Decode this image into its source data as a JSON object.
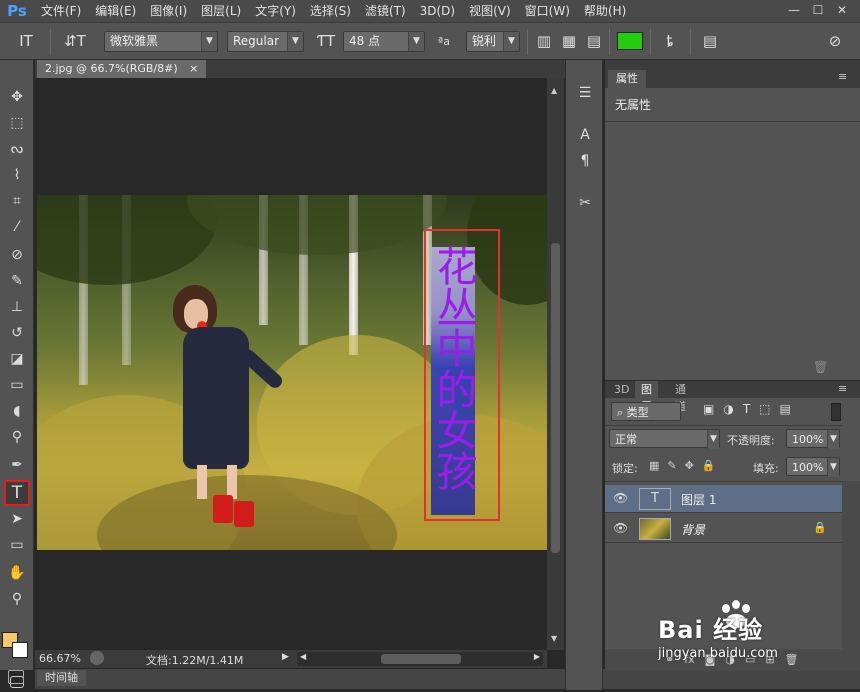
{
  "app": {
    "logo": "Ps"
  },
  "menu": [
    "文件(F)",
    "编辑(E)",
    "图像(I)",
    "图层(L)",
    "文字(Y)",
    "选择(S)",
    "滤镜(T)",
    "3D(D)",
    "视图(V)",
    "窗口(W)",
    "帮助(H)"
  ],
  "window_controls": [
    "—",
    "☐",
    "✕"
  ],
  "options": {
    "font_family": "微软雅黑",
    "font_style": "Regular",
    "font_size": "48 点",
    "aa_label": "ªa",
    "antialias": "锐利",
    "text_color": "#22cc11"
  },
  "document": {
    "tab_title": "2.jpg @ 66.7%(RGB/8#)",
    "tab_close": "×",
    "overlay_text": "花丛中的女孩",
    "overlay_color": "#9a1ee8"
  },
  "status": {
    "zoom": "66.67%",
    "doc_info": "文档:1.22M/1.41M"
  },
  "timeline": {
    "label": "时间轴"
  },
  "properties": {
    "tab": "属性",
    "content": "无属性"
  },
  "layers": {
    "tabs": [
      "3D",
      "图层",
      "通道"
    ],
    "filter_label": "类型",
    "blend_mode": "正常",
    "opacity_label": "不透明度:",
    "opacity_value": "100%",
    "lock_label": "锁定:",
    "fill_label": "填充:",
    "fill_value": "100%",
    "items": [
      {
        "name": "图层 1",
        "thumb": "T",
        "selected": true
      },
      {
        "name": "背景",
        "thumb": "",
        "selected": false
      }
    ]
  },
  "watermark": {
    "brand": "Bai 经验",
    "url": "jingyan.baidu.com"
  }
}
